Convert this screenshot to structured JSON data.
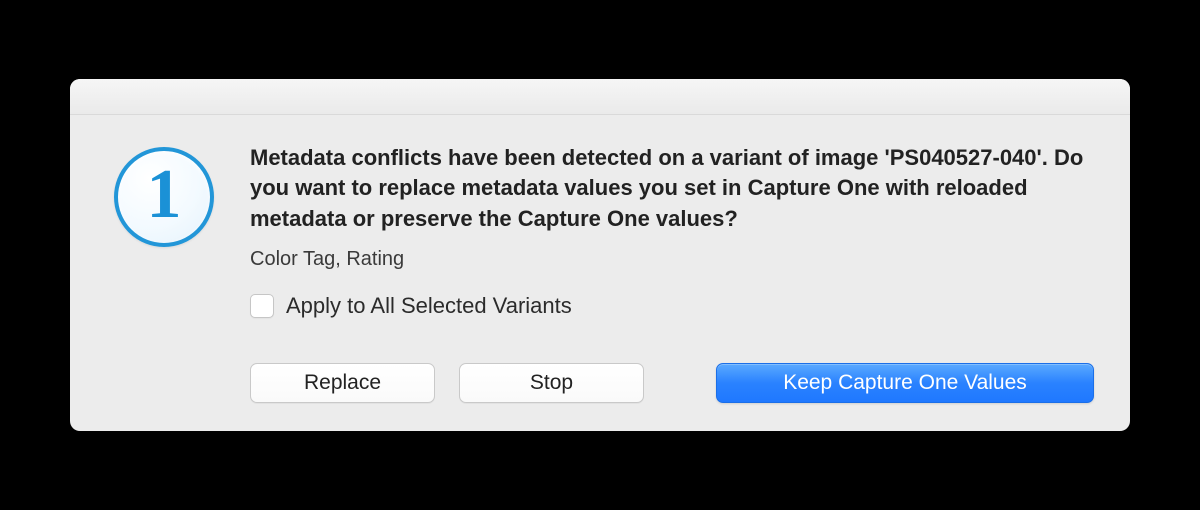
{
  "icon": {
    "glyph": "1"
  },
  "dialog": {
    "heading": "Metadata conflicts have been detected on a variant of image 'PS040527-040'. Do you want to replace metadata values you set in Capture One with reloaded metadata or preserve the Capture One values?",
    "subtext": "Color Tag, Rating",
    "checkbox_label": "Apply to All Selected Variants"
  },
  "buttons": {
    "replace": "Replace",
    "stop": "Stop",
    "keep": "Keep Capture One Values"
  }
}
